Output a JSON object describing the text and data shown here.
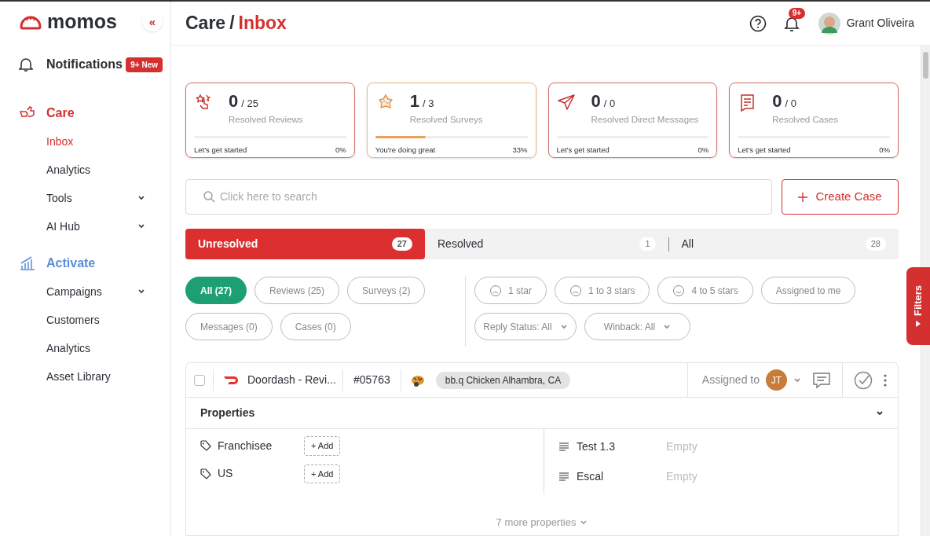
{
  "logo": {
    "text": "momos",
    "collapse": "«"
  },
  "sidebar": {
    "notifications": {
      "label": "Notifications",
      "badge": "9+ New"
    },
    "sections": [
      {
        "label": "Care",
        "color": "#d3302f",
        "items": [
          {
            "label": "Inbox",
            "selected": true,
            "kind": "link"
          },
          {
            "label": "Analytics",
            "selected": false,
            "kind": "link"
          },
          {
            "label": "Tools",
            "selected": false,
            "kind": "group"
          },
          {
            "label": "AI Hub",
            "selected": false,
            "kind": "group"
          }
        ]
      },
      {
        "label": "Activate",
        "color": "#5b8dd9",
        "items": [
          {
            "label": "Campaigns",
            "selected": false,
            "kind": "group"
          },
          {
            "label": "Customers",
            "selected": false,
            "kind": "link"
          },
          {
            "label": "Analytics",
            "selected": false,
            "kind": "link"
          },
          {
            "label": "Asset Library",
            "selected": false,
            "kind": "link"
          }
        ]
      }
    ]
  },
  "header": {
    "breadcrumb": [
      "Care",
      "/",
      "Inbox"
    ],
    "notification_badge": "9+",
    "user": "Grant Oliveira"
  },
  "stats": [
    {
      "value": "0",
      "total": "/ 25",
      "label": "Resolved Reviews",
      "footer": "Let's get started",
      "percent": "0%",
      "level": 0,
      "highlighted": false
    },
    {
      "value": "1",
      "total": "/ 3",
      "label": "Resolved Surveys",
      "footer": "You're doing great",
      "percent": "33%",
      "level": 0.33,
      "highlighted": true
    },
    {
      "value": "0",
      "total": "/ 0",
      "label": "Resolved Direct Messages",
      "footer": "Let's get started",
      "percent": "0%",
      "level": 0,
      "highlighted": false
    },
    {
      "value": "0",
      "total": "/ 0",
      "label": "Resolved Cases",
      "footer": "Let's get started",
      "percent": "0%",
      "level": 0,
      "highlighted": false
    }
  ],
  "search": {
    "placeholder": "Click here to search"
  },
  "create_button": "Create Case",
  "status_tabs": [
    {
      "label": "Unresolved",
      "count": "27",
      "selected": true
    },
    {
      "label": "Resolved",
      "count": "1",
      "selected": false
    },
    {
      "label": "All",
      "count": "28",
      "selected": false
    }
  ],
  "type_filters": [
    {
      "label": "All (27)",
      "selected": true
    },
    {
      "label": "Reviews (25)",
      "selected": false
    },
    {
      "label": "Surveys (2)",
      "selected": false
    },
    {
      "label": "Messages (0)",
      "selected": false
    },
    {
      "label": "Cases (0)",
      "selected": false
    }
  ],
  "rating_filters": [
    {
      "label": "1 star",
      "kind": "sad"
    },
    {
      "label": "1 to 3 stars",
      "kind": "sad"
    },
    {
      "label": "4 to 5 stars",
      "kind": "happy"
    },
    {
      "label": "Assigned to me",
      "kind": "plain"
    }
  ],
  "dropdown_filters": [
    "Reply Status: All",
    "Winback: All"
  ],
  "filters_tab": "Filters",
  "ticket": {
    "checked": false,
    "source": "Doordash - Revi...",
    "id": "#05763",
    "location": "bb.q Chicken Alhambra, CA",
    "assigned_label": "Assigned to",
    "assignee": "JT"
  },
  "properties": {
    "title": "Properties",
    "tags": [
      {
        "label": "Franchisee",
        "button": "+ Add"
      },
      {
        "label": "US",
        "button": "+ Add"
      }
    ],
    "fields": [
      {
        "label": "Test 1.3",
        "value": "Empty"
      },
      {
        "label": "Escal",
        "value": "Empty"
      }
    ],
    "more": "7 more properties"
  }
}
